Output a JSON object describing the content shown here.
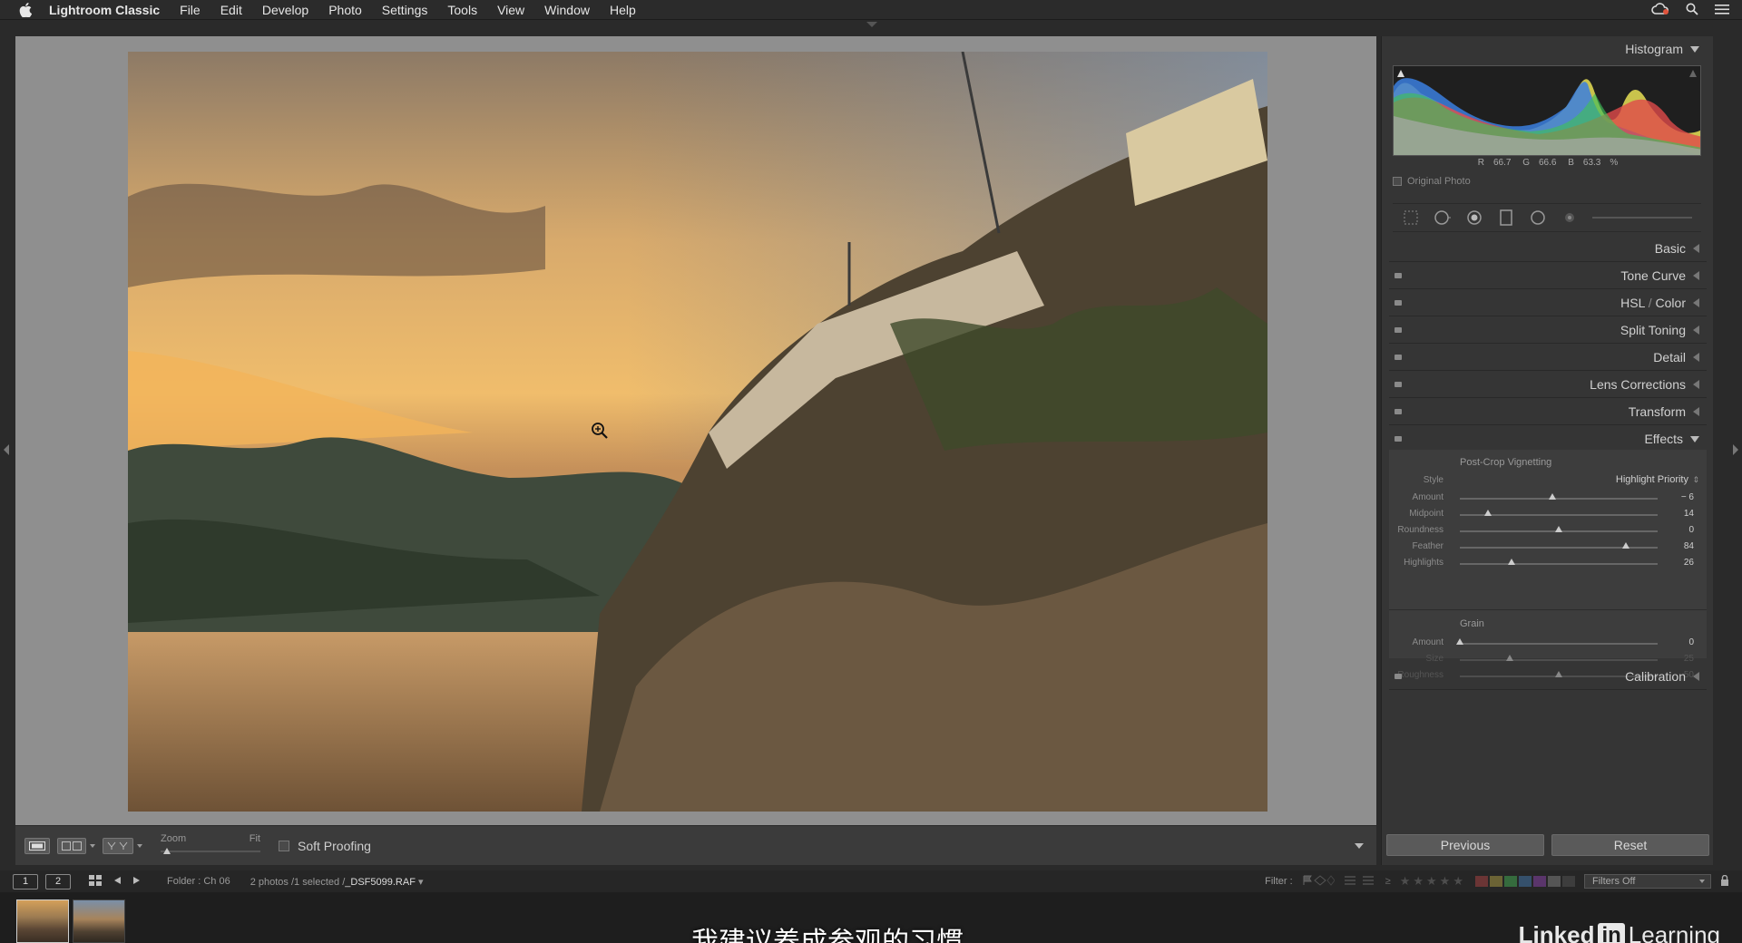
{
  "menubar": {
    "app_name": "Lightroom Classic",
    "items": [
      "File",
      "Edit",
      "Develop",
      "Photo",
      "Settings",
      "Tools",
      "View",
      "Window",
      "Help"
    ]
  },
  "toolbar": {
    "zoom_label": "Zoom",
    "fit_label": "Fit",
    "soft_proofing_label": "Soft Proofing"
  },
  "histogram": {
    "title": "Histogram",
    "r_label": "R",
    "r_value": "66.7",
    "g_label": "G",
    "g_value": "66.6",
    "b_label": "B",
    "b_value": "63.3",
    "unit": "%",
    "original_photo_label": "Original Photo"
  },
  "panels": {
    "basic": "Basic",
    "tone_curve": "Tone Curve",
    "hsl": "HSL",
    "color": "Color",
    "split_toning": "Split Toning",
    "detail": "Detail",
    "lens_corrections": "Lens Corrections",
    "transform": "Transform",
    "effects": "Effects",
    "calibration": "Calibration"
  },
  "effects": {
    "vignette_title": "Post-Crop Vignetting",
    "style_label": "Style",
    "style_value": "Highlight Priority",
    "sliders": [
      {
        "label": "Amount",
        "value": "− 6",
        "position": 0.47
      },
      {
        "label": "Midpoint",
        "value": "14",
        "position": 0.14
      },
      {
        "label": "Roundness",
        "value": "0",
        "position": 0.5
      },
      {
        "label": "Feather",
        "value": "84",
        "position": 0.84
      },
      {
        "label": "Highlights",
        "value": "26",
        "position": 0.26
      }
    ],
    "grain_title": "Grain",
    "grain_sliders": [
      {
        "label": "Amount",
        "value": "0",
        "position": 0.0,
        "dim": false
      },
      {
        "label": "Size",
        "value": "25",
        "position": 0.25,
        "dim": true
      },
      {
        "label": "Roughness",
        "value": "50",
        "position": 0.5,
        "dim": true
      }
    ]
  },
  "buttons": {
    "previous": "Previous",
    "reset": "Reset"
  },
  "filmbar": {
    "screen1": "1",
    "screen2": "2",
    "folder": "Folder : Ch 06",
    "selection_prefix": "2 photos /1 selected /",
    "selection_file": "_DSF5099.RAF",
    "filter_label": "Filter :",
    "filters_value": "Filters Off"
  },
  "overlay": {
    "subtitle": "我建议养成参观的习惯",
    "brand_left": "Linked",
    "brand_in": "in",
    "brand_right": "Learning"
  },
  "colors": {
    "panel_bg": "#353535",
    "loupe_bg": "#8f8f8f",
    "accent_text": "#d0d0d0"
  }
}
